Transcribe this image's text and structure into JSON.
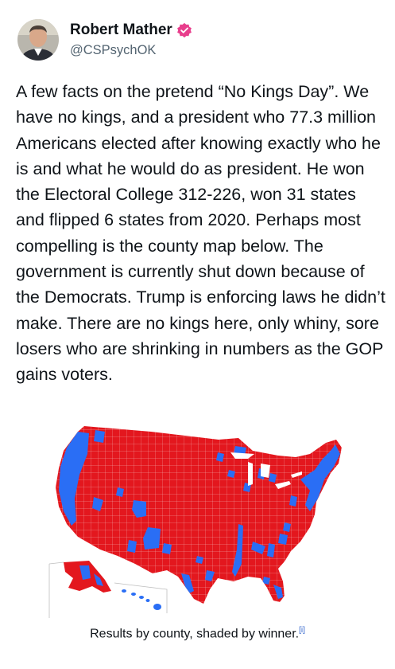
{
  "user": {
    "display_name": "Robert Mather",
    "handle": "@CSPsychOK",
    "verified": true,
    "avatar_icon": "profile-photo"
  },
  "tweet": {
    "text": "A few facts on the pretend “No Kings Day”. We have no kings, and a president who 77.3 million Americans elected after knowing exactly who he is and what he would do as president. He won the Electoral College 312-226, won 31 states and flipped 6 states from 2020. Perhaps most compelling is the county map below. The government is currently shut down because of the Democrats. Trump is enforcing laws he didn’t make. There are no kings here, only whiny, sore losers who are shrinking in numbers as the GOP gains voters."
  },
  "media": {
    "caption": "Results by county, shaded by winner.",
    "citation": "[i]",
    "colors": {
      "republican": "#e3171e",
      "democrat": "#2a6ef5",
      "border": "#f4b8b8"
    }
  }
}
